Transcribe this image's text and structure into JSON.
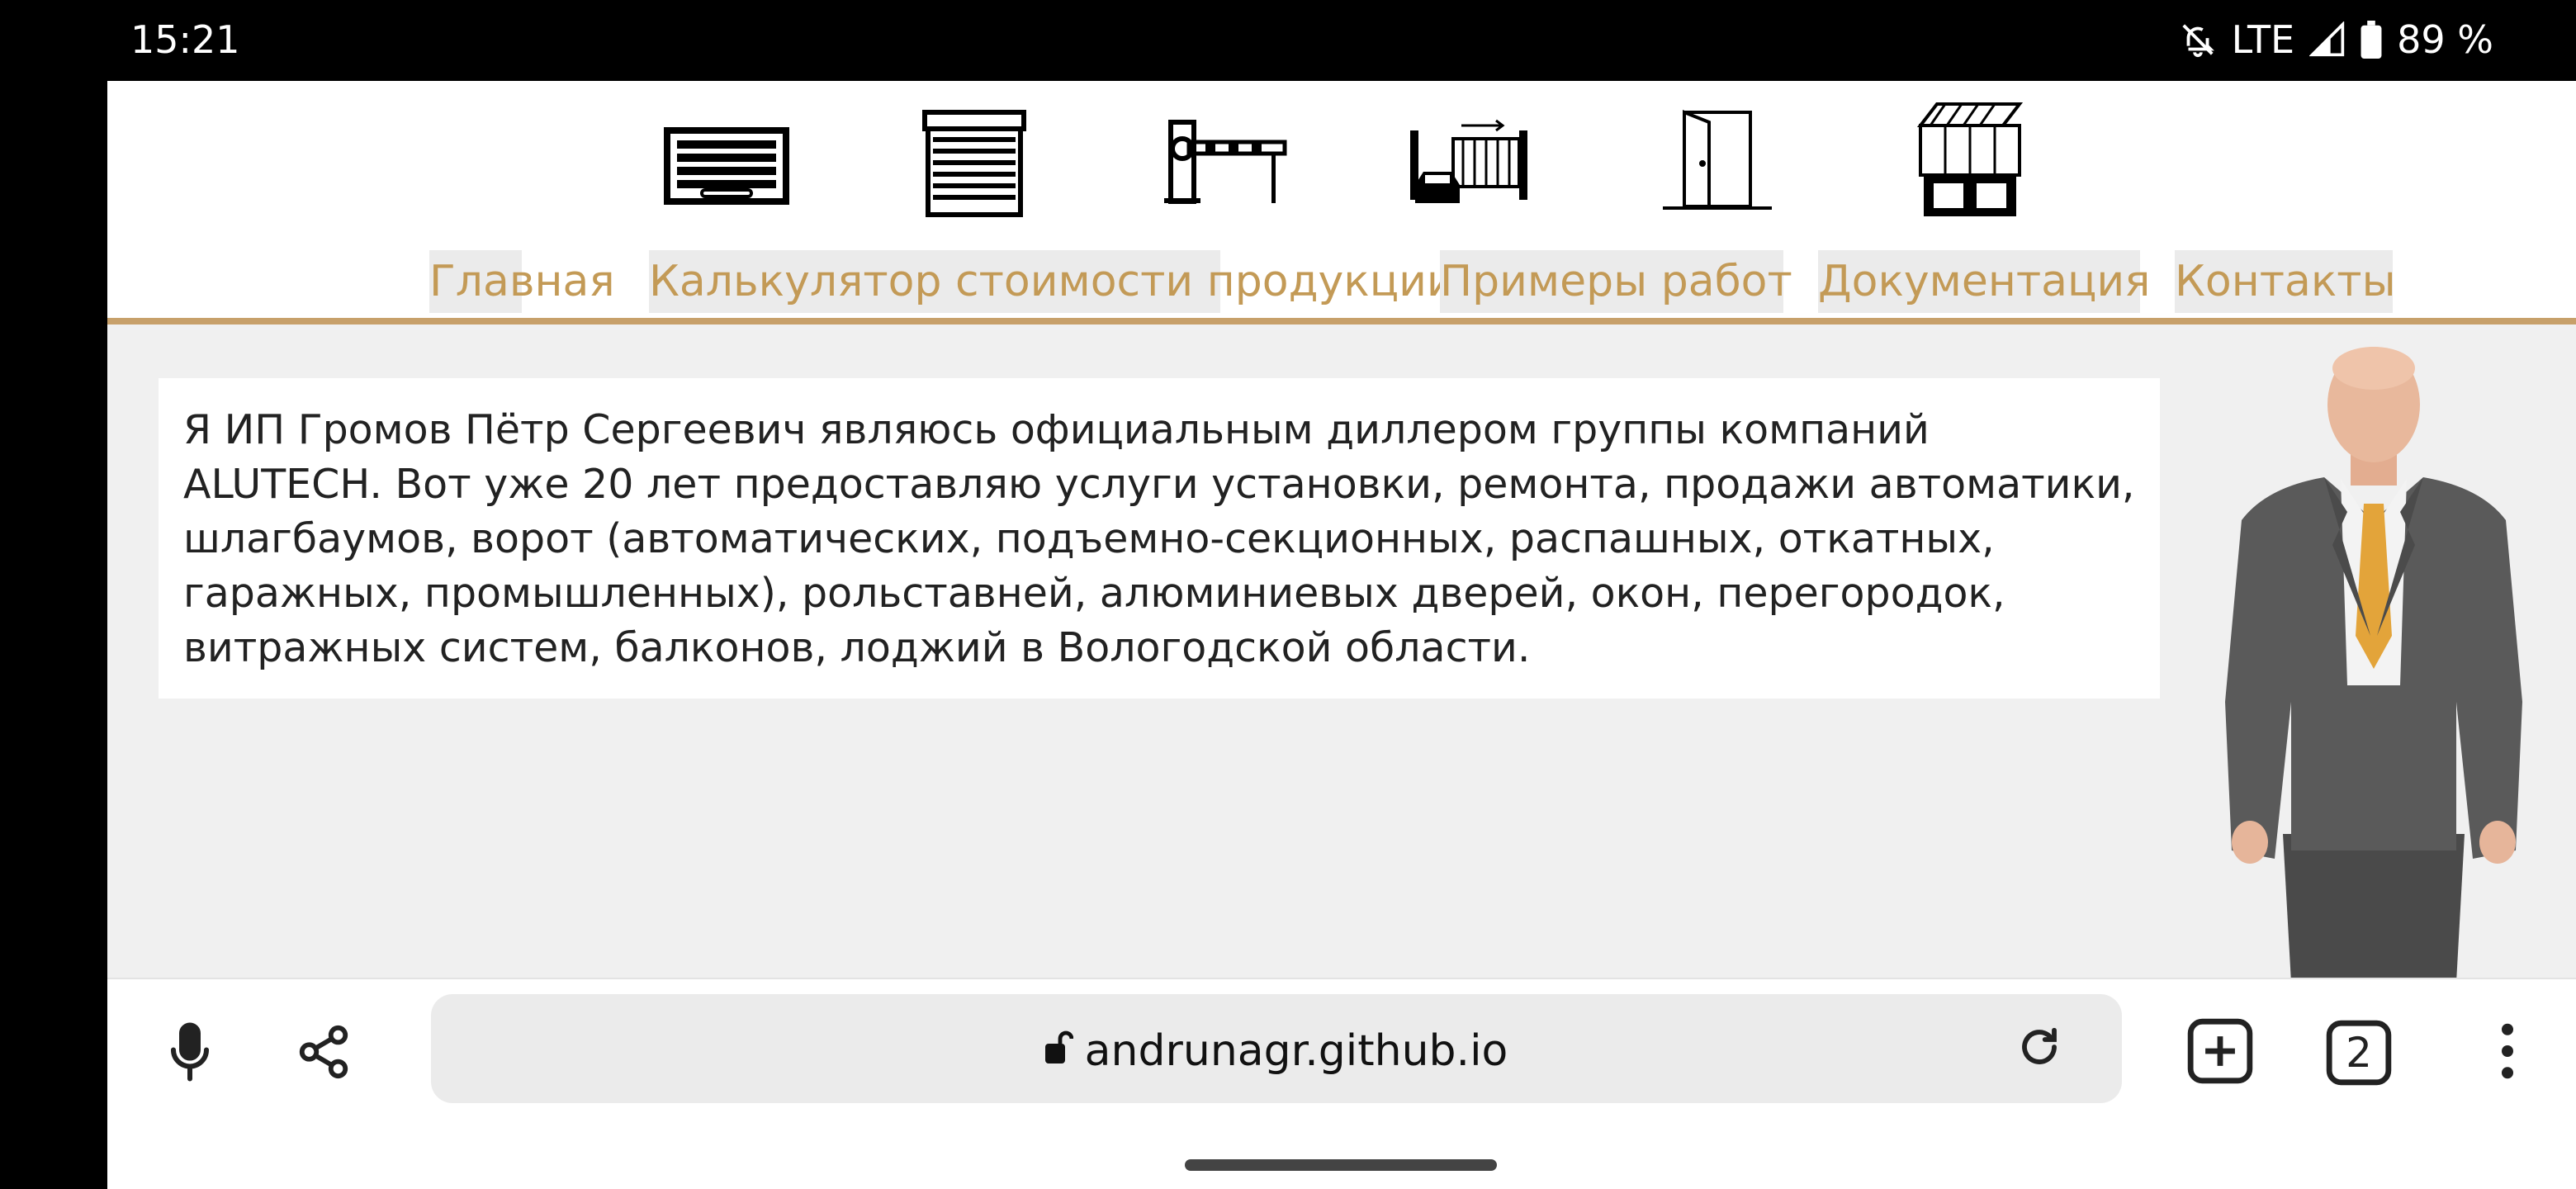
{
  "status_bar": {
    "time": "15:21",
    "network": "LTE",
    "battery": "89 %",
    "icons": [
      "bell-off-icon",
      "signal-icon",
      "battery-icon"
    ]
  },
  "site": {
    "product_icons": [
      "garage-door-icon",
      "roller-shutter-icon",
      "barrier-icon",
      "sliding-gate-icon",
      "door-icon",
      "glazing-icon"
    ],
    "nav": [
      "Главная",
      "Калькулятор стоимости продукции",
      "Примеры работ",
      "Документация",
      "Контакты"
    ],
    "intro_text": "Я ИП Громов Пётр Сергеевич являюсь официальным диллером группы компаний ALUTECH. Вот уже 20 лет предоставляю услуги установки, ремонта, продажи автоматики, шлагбаумов, ворот (автоматических, подъемно-секционных, распашных, откатных, гаражных, промышленных), рольставней, алюминиевых дверей, окон, перегородок, витражных систем, балконов, лоджий в Вологодской области.",
    "colors": {
      "accent": "#c39a56",
      "nav_bg": "#ebebeb",
      "rule": "#c7a06a"
    }
  },
  "browser": {
    "url": "andrunagr.github.io",
    "tab_count": "2",
    "icons": [
      "mic-icon",
      "share-icon",
      "lock-icon",
      "reload-icon",
      "new-tab-icon",
      "tabs-icon",
      "menu-icon"
    ]
  }
}
